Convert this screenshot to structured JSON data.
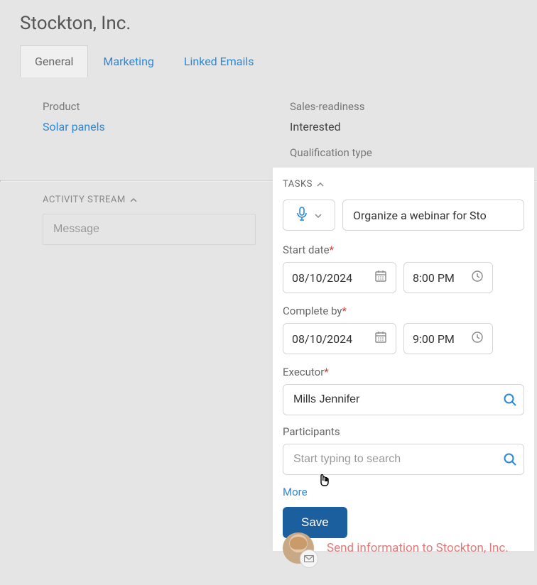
{
  "header": {
    "title": "Stockton, Inc."
  },
  "tabs": [
    {
      "label": "General",
      "active": true
    },
    {
      "label": "Marketing",
      "active": false
    },
    {
      "label": "Linked Emails",
      "active": false
    }
  ],
  "info": {
    "product_label": "Product",
    "product_value": "Solar panels",
    "readiness_label": "Sales-readiness",
    "readiness_value": "Interested",
    "qualification_label": "Qualification type"
  },
  "activity": {
    "heading": "ACTIVITY STREAM",
    "message_placeholder": "Message"
  },
  "tasks": {
    "heading": "TASKS",
    "title_value": "Organize a webinar for Sto",
    "start_label": "Start date",
    "start_date": "08/10/2024",
    "start_time": "8:00 PM",
    "complete_label": "Complete by",
    "complete_date": "08/10/2024",
    "complete_time": "9:00 PM",
    "executor_label": "Executor",
    "executor_value": "Mills Jennifer",
    "participants_label": "Participants",
    "participants_placeholder": "Start typing to search",
    "more_label": "More",
    "save_label": "Save"
  },
  "footer_activity": {
    "link_text": "Send information to Stockton, Inc."
  }
}
